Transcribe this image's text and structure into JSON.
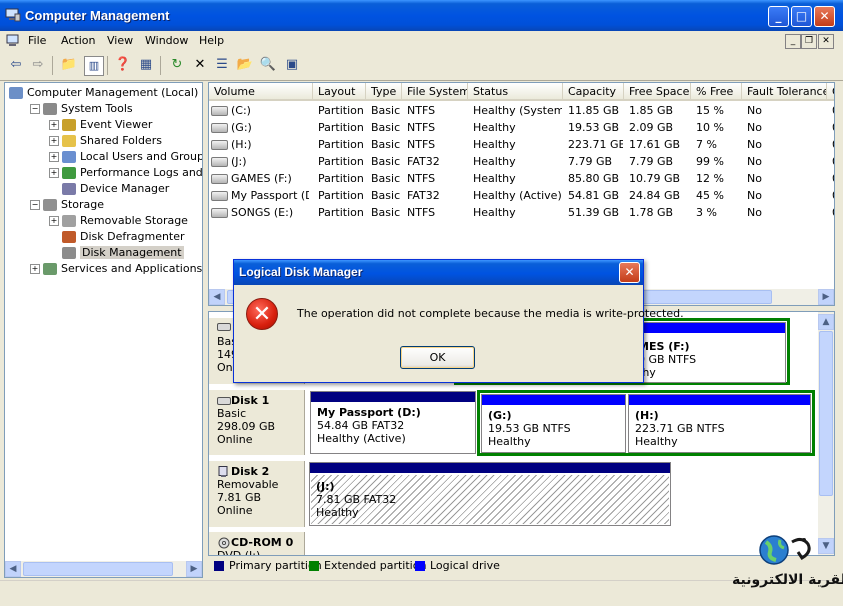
{
  "window": {
    "title": "Computer Management"
  },
  "menu": [
    "File",
    "Action",
    "View",
    "Window",
    "Help"
  ],
  "tree": {
    "items": [
      {
        "label": "Computer Management (Local)",
        "level": 0,
        "icon": "computer-icon",
        "expander": ""
      },
      {
        "label": "System Tools",
        "level": 1,
        "icon": "tools-icon",
        "expander": "-"
      },
      {
        "label": "Event Viewer",
        "level": 2,
        "icon": "event-viewer-icon",
        "expander": "+"
      },
      {
        "label": "Shared Folders",
        "level": 2,
        "icon": "shared-folders-icon",
        "expander": "+"
      },
      {
        "label": "Local Users and Groups",
        "level": 2,
        "icon": "users-icon",
        "expander": "+"
      },
      {
        "label": "Performance Logs and Alerts",
        "level": 2,
        "icon": "performance-icon",
        "expander": "+"
      },
      {
        "label": "Device Manager",
        "level": 2,
        "icon": "device-manager-icon",
        "expander": ""
      },
      {
        "label": "Storage",
        "level": 1,
        "icon": "storage-icon",
        "expander": "-"
      },
      {
        "label": "Removable Storage",
        "level": 2,
        "icon": "removable-storage-icon",
        "expander": "+"
      },
      {
        "label": "Disk Defragmenter",
        "level": 2,
        "icon": "defrag-icon",
        "expander": ""
      },
      {
        "label": "Disk Management",
        "level": 2,
        "icon": "disk-management-icon",
        "expander": "",
        "selected": true
      },
      {
        "label": "Services and Applications",
        "level": 1,
        "icon": "services-icon",
        "expander": "+"
      }
    ]
  },
  "volumes": {
    "columns": [
      "Volume",
      "Layout",
      "Type",
      "File System",
      "Status",
      "Capacity",
      "Free Space",
      "% Free",
      "Fault Tolerance",
      "O"
    ],
    "rows": [
      [
        "(C:)",
        "Partition",
        "Basic",
        "NTFS",
        "Healthy (System)",
        "11.85 GB",
        "1.85 GB",
        "15 %",
        "No",
        "0"
      ],
      [
        "(G:)",
        "Partition",
        "Basic",
        "NTFS",
        "Healthy",
        "19.53 GB",
        "2.09 GB",
        "10 %",
        "No",
        "0"
      ],
      [
        "(H:)",
        "Partition",
        "Basic",
        "NTFS",
        "Healthy",
        "223.71 GB",
        "17.61 GB",
        "7 %",
        "No",
        "0"
      ],
      [
        "(J:)",
        "Partition",
        "Basic",
        "FAT32",
        "Healthy",
        "7.79 GB",
        "7.79 GB",
        "99 %",
        "No",
        "0"
      ],
      [
        "GAMES (F:)",
        "Partition",
        "Basic",
        "NTFS",
        "Healthy",
        "85.80 GB",
        "10.79 GB",
        "12 %",
        "No",
        "0"
      ],
      [
        "My Passport (D:)",
        "Partition",
        "Basic",
        "FAT32",
        "Healthy (Active)",
        "54.81 GB",
        "24.84 GB",
        "45 %",
        "No",
        "0"
      ],
      [
        "SONGS (E:)",
        "Partition",
        "Basic",
        "NTFS",
        "Healthy",
        "51.39 GB",
        "1.78 GB",
        "3 %",
        "No",
        "0"
      ]
    ]
  },
  "disks": {
    "disk0": {
      "type": "Basic",
      "size": "149",
      "status": "Onli",
      "games_name": "MES  (F:)",
      "games_info": "0 GB NTFS",
      "games_status": "thy"
    },
    "disk1": {
      "name": "Disk 1",
      "type": "Basic",
      "size": "298.09 GB",
      "status": "Online",
      "parts": [
        {
          "name": "My Passport  (D:)",
          "info": "54.84 GB FAT32",
          "status": "Healthy (Active)"
        },
        {
          "name": "(G:)",
          "info": "19.53 GB NTFS",
          "status": "Healthy"
        },
        {
          "name": "(H:)",
          "info": "223.71 GB NTFS",
          "status": "Healthy"
        }
      ]
    },
    "disk2": {
      "name": "Disk 2",
      "type": "Removable",
      "size": "7.81 GB",
      "status": "Online",
      "part": {
        "name": "(J:)",
        "info": "7.81 GB FAT32",
        "status": "Healthy"
      }
    },
    "cdrom": {
      "name": "CD-ROM 0",
      "type": "DVD (I:)"
    }
  },
  "legend": {
    "primary": "Primary partition",
    "extended": "Extended partition",
    "logical": "Logical drive",
    "colors": {
      "primary": "#000080",
      "extended": "#008000",
      "logical": "#0000ff"
    }
  },
  "dialog": {
    "title": "Logical Disk Manager",
    "message": "The operation did not complete because the media is write-protected.",
    "ok": "OK",
    "icon": "error-icon"
  },
  "watermark": {
    "text": "القرية الالكترونية"
  }
}
